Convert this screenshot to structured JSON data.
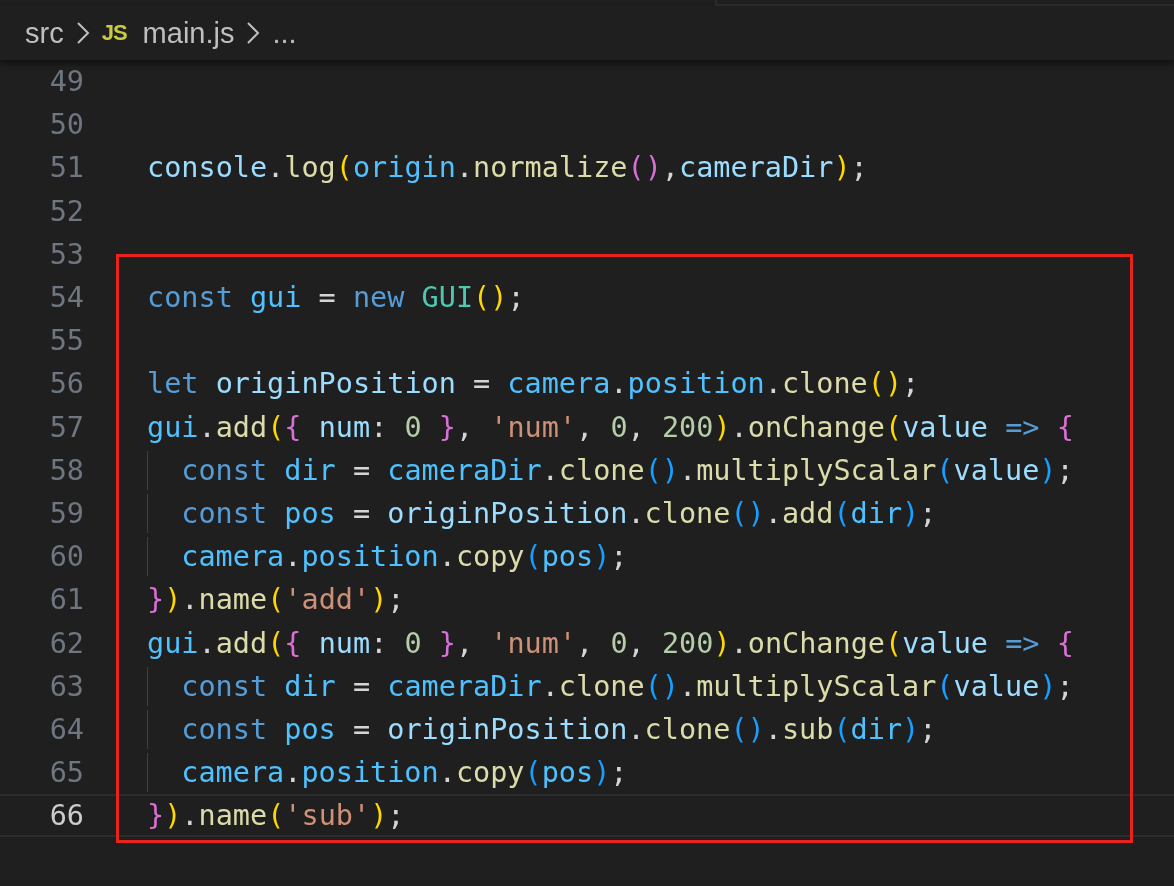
{
  "breadcrumb": [
    {
      "kind": "folder",
      "text": "src"
    },
    {
      "kind": "file",
      "icon": "JS",
      "text": "main.js"
    },
    {
      "kind": "more",
      "text": "..."
    }
  ],
  "lines": [
    {
      "number": "49",
      "current": false
    },
    {
      "number": "50",
      "current": false
    },
    {
      "number": "51",
      "current": false,
      "tokens": [
        {
          "kind": "var",
          "text": "console"
        },
        {
          "kind": "p",
          "text": "."
        },
        {
          "kind": "fn",
          "text": "log"
        },
        {
          "kind": "b1",
          "text": "("
        },
        {
          "kind": "const",
          "text": "origin"
        },
        {
          "kind": "p",
          "text": "."
        },
        {
          "kind": "fn",
          "text": "normalize"
        },
        {
          "kind": "b2",
          "text": "()"
        },
        {
          "kind": "p",
          "text": ","
        },
        {
          "kind": "var",
          "text": "cameraDir"
        },
        {
          "kind": "b1",
          "text": ")"
        },
        {
          "kind": "p",
          "text": ";"
        }
      ]
    },
    {
      "number": "52",
      "current": false
    },
    {
      "number": "53",
      "current": false
    }
  ],
  "highlighted_block": {
    "lines": [
      {
        "number": "54",
        "current": false,
        "tokens": [
          {
            "kind": "kw",
            "text": "const "
          },
          {
            "kind": "const",
            "text": "gui"
          },
          {
            "kind": "p",
            "text": " = "
          },
          {
            "kind": "kw",
            "text": "new "
          },
          {
            "kind": "cls",
            "text": "GUI"
          },
          {
            "kind": "b1",
            "text": "()"
          },
          {
            "kind": "p",
            "text": ";"
          }
        ]
      },
      {
        "number": "55",
        "current": false
      },
      {
        "number": "56",
        "current": false,
        "tokens": [
          {
            "kind": "kw",
            "text": "let "
          },
          {
            "kind": "var",
            "text": "originPosition"
          },
          {
            "kind": "p",
            "text": " = "
          },
          {
            "kind": "const",
            "text": "camera"
          },
          {
            "kind": "p",
            "text": "."
          },
          {
            "kind": "const",
            "text": "position"
          },
          {
            "kind": "p",
            "text": "."
          },
          {
            "kind": "fn",
            "text": "clone"
          },
          {
            "kind": "b1",
            "text": "()"
          },
          {
            "kind": "p",
            "text": ";"
          }
        ]
      },
      {
        "number": "57",
        "current": false,
        "tokens": [
          {
            "kind": "const",
            "text": "gui"
          },
          {
            "kind": "p",
            "text": "."
          },
          {
            "kind": "fn",
            "text": "add"
          },
          {
            "kind": "b1",
            "text": "("
          },
          {
            "kind": "b2",
            "text": "{ "
          },
          {
            "kind": "var",
            "text": "num"
          },
          {
            "kind": "p",
            "text": ": "
          },
          {
            "kind": "num",
            "text": "0"
          },
          {
            "kind": "b2",
            "text": " }"
          },
          {
            "kind": "p",
            "text": ", "
          },
          {
            "kind": "str",
            "text": "'num'"
          },
          {
            "kind": "p",
            "text": ", "
          },
          {
            "kind": "num",
            "text": "0"
          },
          {
            "kind": "p",
            "text": ", "
          },
          {
            "kind": "num",
            "text": "200"
          },
          {
            "kind": "b1",
            "text": ")"
          },
          {
            "kind": "p",
            "text": "."
          },
          {
            "kind": "fn",
            "text": "onChange"
          },
          {
            "kind": "b1",
            "text": "("
          },
          {
            "kind": "var",
            "text": "value"
          },
          {
            "kind": "kw",
            "text": " => "
          },
          {
            "kind": "b2",
            "text": "{"
          }
        ],
        "children": [
          {
            "number": "58",
            "current": false,
            "tokens": [
              {
                "kind": "kw",
                "text": "const "
              },
              {
                "kind": "const",
                "text": "dir"
              },
              {
                "kind": "p",
                "text": " = "
              },
              {
                "kind": "const",
                "text": "cameraDir"
              },
              {
                "kind": "p",
                "text": "."
              },
              {
                "kind": "fn",
                "text": "clone"
              },
              {
                "kind": "b3",
                "text": "()"
              },
              {
                "kind": "p",
                "text": "."
              },
              {
                "kind": "fn",
                "text": "multiplyScalar"
              },
              {
                "kind": "b3",
                "text": "("
              },
              {
                "kind": "var",
                "text": "value"
              },
              {
                "kind": "b3",
                "text": ")"
              },
              {
                "kind": "p",
                "text": ";"
              }
            ]
          },
          {
            "number": "59",
            "current": false,
            "tokens": [
              {
                "kind": "kw",
                "text": "const "
              },
              {
                "kind": "const",
                "text": "pos"
              },
              {
                "kind": "p",
                "text": " = "
              },
              {
                "kind": "var",
                "text": "originPosition"
              },
              {
                "kind": "p",
                "text": "."
              },
              {
                "kind": "fn",
                "text": "clone"
              },
              {
                "kind": "b3",
                "text": "()"
              },
              {
                "kind": "p",
                "text": "."
              },
              {
                "kind": "fn",
                "text": "add"
              },
              {
                "kind": "b3",
                "text": "("
              },
              {
                "kind": "const",
                "text": "dir"
              },
              {
                "kind": "b3",
                "text": ")"
              },
              {
                "kind": "p",
                "text": ";"
              }
            ]
          },
          {
            "number": "60",
            "current": false,
            "tokens": [
              {
                "kind": "const",
                "text": "camera"
              },
              {
                "kind": "p",
                "text": "."
              },
              {
                "kind": "const",
                "text": "position"
              },
              {
                "kind": "p",
                "text": "."
              },
              {
                "kind": "fn",
                "text": "copy"
              },
              {
                "kind": "b3",
                "text": "("
              },
              {
                "kind": "const",
                "text": "pos"
              },
              {
                "kind": "b3",
                "text": ")"
              },
              {
                "kind": "p",
                "text": ";"
              }
            ]
          }
        ]
      },
      {
        "number": "61",
        "current": false,
        "tokens": [
          {
            "kind": "b2",
            "text": "}"
          },
          {
            "kind": "b1",
            "text": ")"
          },
          {
            "kind": "p",
            "text": "."
          },
          {
            "kind": "fn",
            "text": "name"
          },
          {
            "kind": "b1",
            "text": "("
          },
          {
            "kind": "str",
            "text": "'add'"
          },
          {
            "kind": "b1",
            "text": ")"
          },
          {
            "kind": "p",
            "text": ";"
          }
        ]
      },
      {
        "number": "62",
        "current": false,
        "tokens": [
          {
            "kind": "const",
            "text": "gui"
          },
          {
            "kind": "p",
            "text": "."
          },
          {
            "kind": "fn",
            "text": "add"
          },
          {
            "kind": "b1",
            "text": "("
          },
          {
            "kind": "b2",
            "text": "{ "
          },
          {
            "kind": "var",
            "text": "num"
          },
          {
            "kind": "p",
            "text": ": "
          },
          {
            "kind": "num",
            "text": "0"
          },
          {
            "kind": "b2",
            "text": " }"
          },
          {
            "kind": "p",
            "text": ", "
          },
          {
            "kind": "str",
            "text": "'num'"
          },
          {
            "kind": "p",
            "text": ", "
          },
          {
            "kind": "num",
            "text": "0"
          },
          {
            "kind": "p",
            "text": ", "
          },
          {
            "kind": "num",
            "text": "200"
          },
          {
            "kind": "b1",
            "text": ")"
          },
          {
            "kind": "p",
            "text": "."
          },
          {
            "kind": "fn",
            "text": "onChange"
          },
          {
            "kind": "b1",
            "text": "("
          },
          {
            "kind": "var",
            "text": "value"
          },
          {
            "kind": "kw",
            "text": " => "
          },
          {
            "kind": "b2",
            "text": "{"
          }
        ],
        "children": [
          {
            "number": "63",
            "current": false,
            "tokens": [
              {
                "kind": "kw",
                "text": "const "
              },
              {
                "kind": "const",
                "text": "dir"
              },
              {
                "kind": "p",
                "text": " = "
              },
              {
                "kind": "const",
                "text": "cameraDir"
              },
              {
                "kind": "p",
                "text": "."
              },
              {
                "kind": "fn",
                "text": "clone"
              },
              {
                "kind": "b3",
                "text": "()"
              },
              {
                "kind": "p",
                "text": "."
              },
              {
                "kind": "fn",
                "text": "multiplyScalar"
              },
              {
                "kind": "b3",
                "text": "("
              },
              {
                "kind": "var",
                "text": "value"
              },
              {
                "kind": "b3",
                "text": ")"
              },
              {
                "kind": "p",
                "text": ";"
              }
            ]
          },
          {
            "number": "64",
            "current": false,
            "tokens": [
              {
                "kind": "kw",
                "text": "const "
              },
              {
                "kind": "const",
                "text": "pos"
              },
              {
                "kind": "p",
                "text": " = "
              },
              {
                "kind": "var",
                "text": "originPosition"
              },
              {
                "kind": "p",
                "text": "."
              },
              {
                "kind": "fn",
                "text": "clone"
              },
              {
                "kind": "b3",
                "text": "()"
              },
              {
                "kind": "p",
                "text": "."
              },
              {
                "kind": "fn",
                "text": "sub"
              },
              {
                "kind": "b3",
                "text": "("
              },
              {
                "kind": "const",
                "text": "dir"
              },
              {
                "kind": "b3",
                "text": ")"
              },
              {
                "kind": "p",
                "text": ";"
              }
            ]
          },
          {
            "number": "65",
            "current": false,
            "tokens": [
              {
                "kind": "const",
                "text": "camera"
              },
              {
                "kind": "p",
                "text": "."
              },
              {
                "kind": "const",
                "text": "position"
              },
              {
                "kind": "p",
                "text": "."
              },
              {
                "kind": "fn",
                "text": "copy"
              },
              {
                "kind": "b3",
                "text": "("
              },
              {
                "kind": "const",
                "text": "pos"
              },
              {
                "kind": "b3",
                "text": ")"
              },
              {
                "kind": "p",
                "text": ";"
              }
            ]
          }
        ]
      },
      {
        "number": "66",
        "current": true,
        "tokens": [
          {
            "kind": "b2",
            "text": "}"
          },
          {
            "kind": "b1",
            "text": ")"
          },
          {
            "kind": "p",
            "text": "."
          },
          {
            "kind": "fn",
            "text": "name"
          },
          {
            "kind": "b1",
            "text": "("
          },
          {
            "kind": "str",
            "text": "'sub'"
          },
          {
            "kind": "b1",
            "text": ")"
          },
          {
            "kind": "p",
            "text": ";"
          }
        ]
      }
    ]
  }
}
